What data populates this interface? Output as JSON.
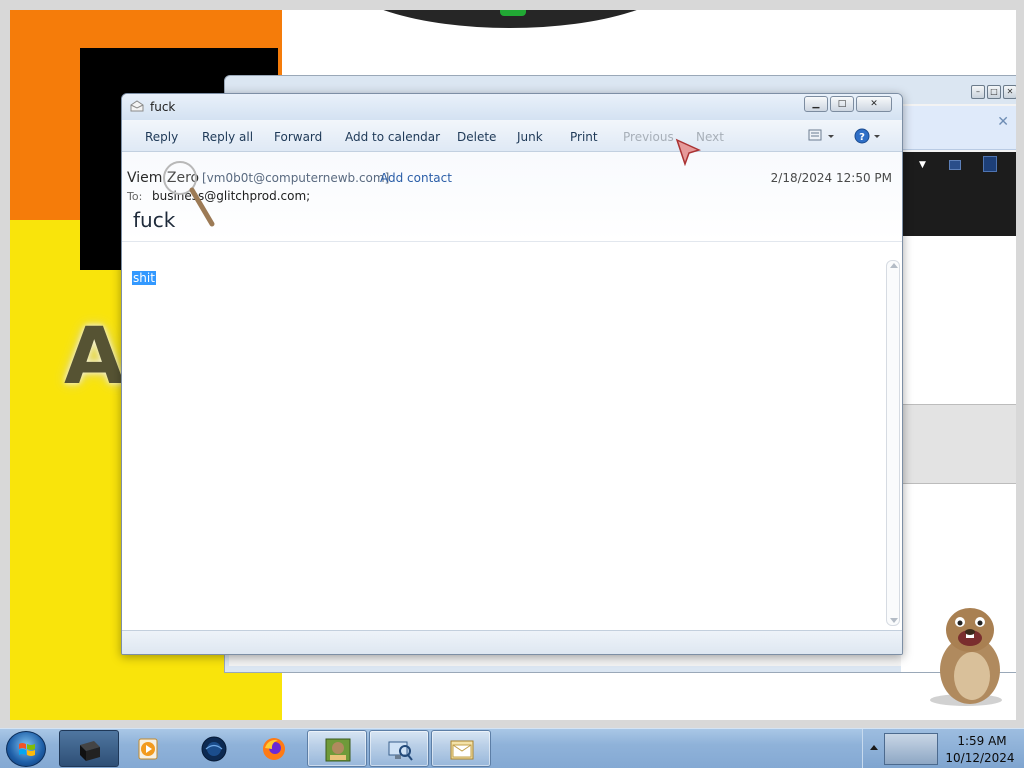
{
  "mail_window": {
    "title": "fuck",
    "toolbar": {
      "reply": "Reply",
      "reply_all": "Reply all",
      "forward": "Forward",
      "add_to_calendar": "Add to calendar",
      "delete": "Delete",
      "junk": "Junk",
      "print": "Print",
      "previous": "Previous",
      "next": "Next"
    },
    "header": {
      "from_name": "Viem Zero",
      "from_email": "[vm0b0t@computernewb.com]",
      "add_contact": "Add contact",
      "date": "2/18/2024 12:50 PM",
      "to_label": "To:",
      "to": "business@glitchprod.com;",
      "subject": "fuck"
    },
    "body": {
      "selected_text": "shit"
    }
  },
  "taskbar": {
    "clock_time": "1:59 AM",
    "clock_date": "10/12/2024"
  },
  "colors": {
    "selection": "#3399ff",
    "link": "#2b5ea8",
    "taskbar": "#8fb2d9",
    "bg_orange": "#f57c0a",
    "bg_yellow": "#f9e40b"
  }
}
